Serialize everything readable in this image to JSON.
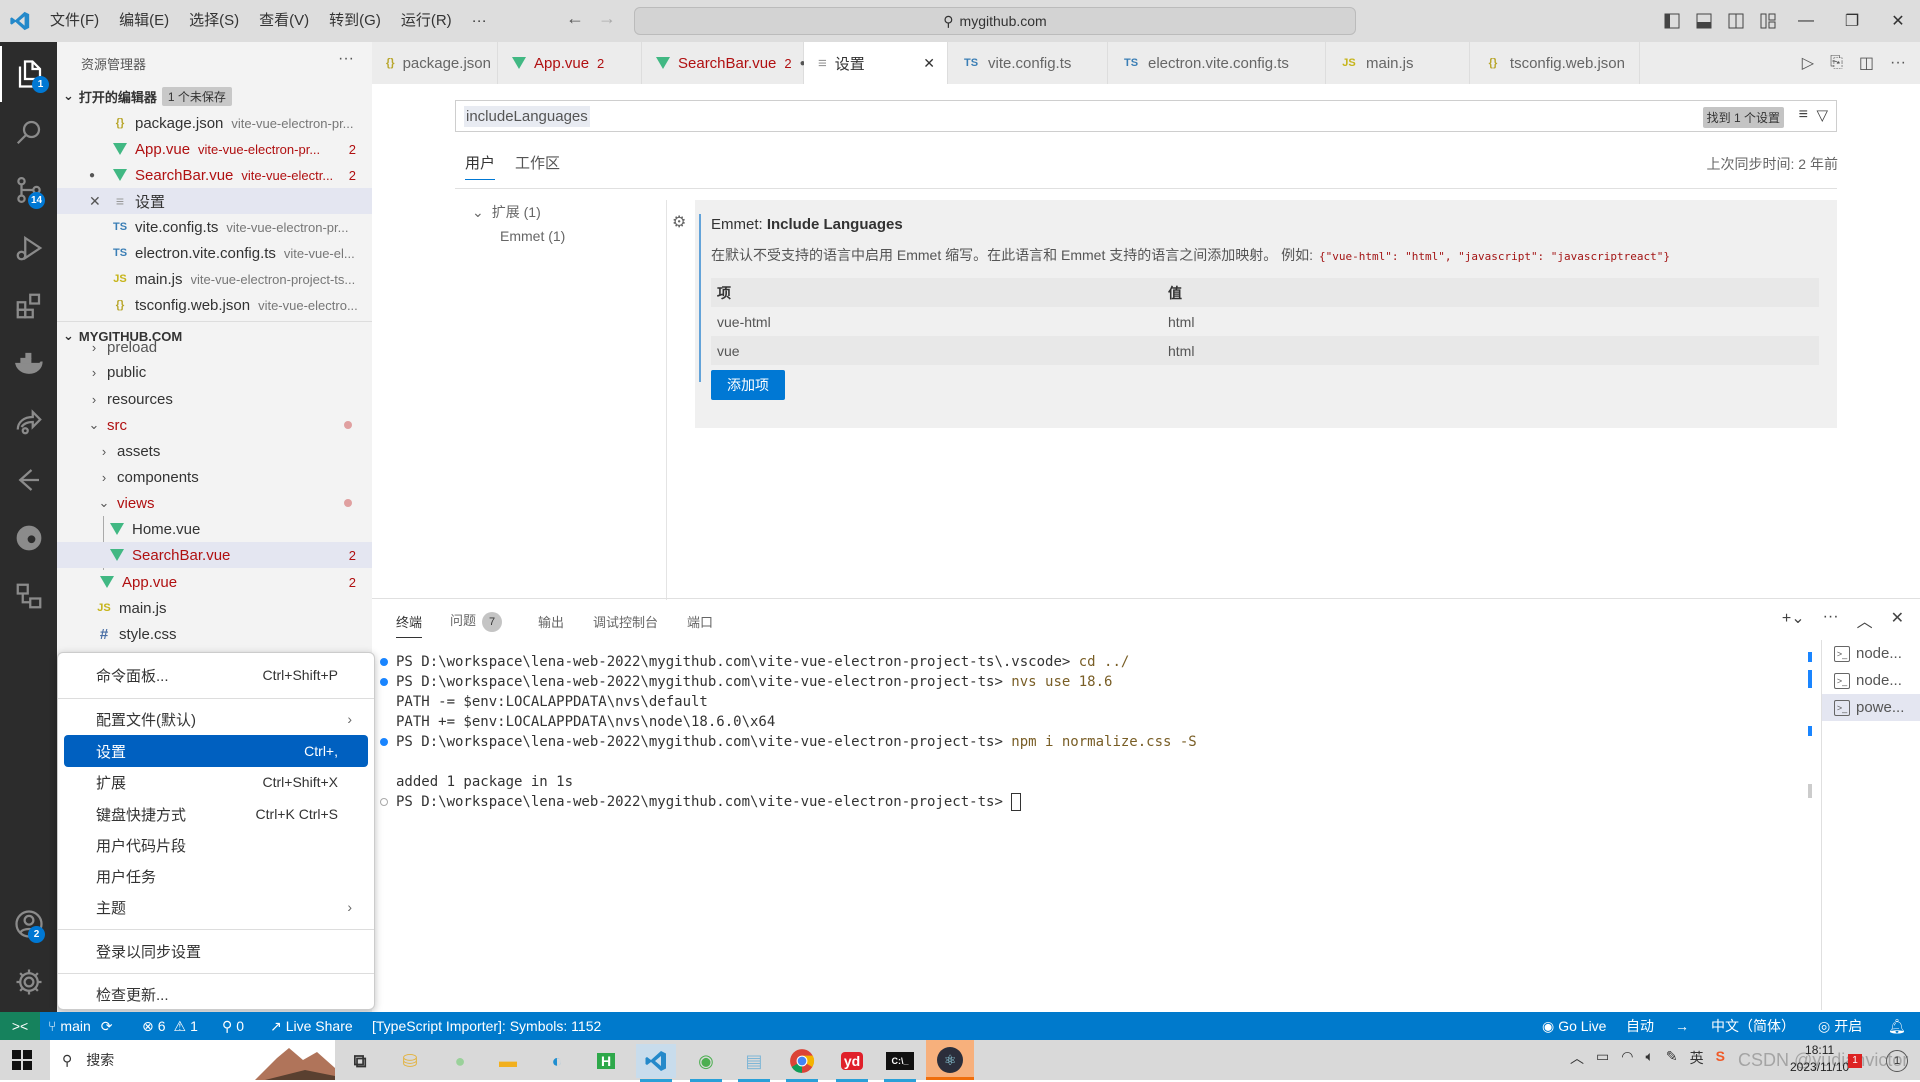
{
  "titlebar": {
    "menus": [
      "文件(F)",
      "编辑(E)",
      "选择(S)",
      "查看(V)",
      "转到(G)",
      "运行(R)",
      "···"
    ],
    "command_center": "mygithub.com"
  },
  "activity": {
    "explorer_badge": "1",
    "scm_badge": "14",
    "accounts_badge": "2"
  },
  "sidebar": {
    "title": "资源管理器",
    "more": "···",
    "open_editors": {
      "label": "打开的编辑器",
      "unsaved_badge": "1 个未保存",
      "items": [
        {
          "icon": "json-icon",
          "name": "package.json",
          "desc": "vite-vue-electron-pr...",
          "count": "",
          "error": false
        },
        {
          "icon": "vue-icon",
          "name": "App.vue",
          "desc": "vite-vue-electron-pr...",
          "count": "2",
          "error": true
        },
        {
          "icon": "vue-icon",
          "name": "SearchBar.vue",
          "desc": "vite-vue-electr...",
          "count": "2",
          "error": true
        },
        {
          "icon": "settings-file-icon",
          "name": "设置",
          "desc": "",
          "count": "",
          "error": false
        },
        {
          "icon": "ts-icon",
          "name": "vite.config.ts",
          "desc": "vite-vue-electron-pr...",
          "count": "",
          "error": false
        },
        {
          "icon": "ts-icon",
          "name": "electron.vite.config.ts",
          "desc": "vite-vue-el...",
          "count": "",
          "error": false
        },
        {
          "icon": "js-icon",
          "name": "main.js",
          "desc": "vite-vue-electron-project-ts...",
          "count": "",
          "error": false
        },
        {
          "icon": "json-icon",
          "name": "tsconfig.web.json",
          "desc": "vite-vue-electro...",
          "count": "",
          "error": false
        }
      ]
    },
    "workspace": {
      "label": "MYGITHUB.COM",
      "items": [
        {
          "name": "preload",
          "type": "folder"
        },
        {
          "name": "public",
          "type": "folder"
        },
        {
          "name": "resources",
          "type": "folder"
        },
        {
          "name": "src",
          "type": "folder-open"
        },
        {
          "name": "assets",
          "type": "folder"
        },
        {
          "name": "components",
          "type": "folder"
        },
        {
          "name": "views",
          "type": "folder-open"
        },
        {
          "name": "Home.vue",
          "type": "vue"
        },
        {
          "name": "SearchBar.vue",
          "type": "vue",
          "count": "2"
        },
        {
          "name": "App.vue",
          "type": "vue",
          "count": "2"
        },
        {
          "name": "main.js",
          "type": "js"
        },
        {
          "name": "style.css",
          "type": "css"
        }
      ]
    }
  },
  "tabs": [
    {
      "icon": "json-icon",
      "label": "package.json",
      "count": ""
    },
    {
      "icon": "vue-icon",
      "label": "App.vue",
      "count": "2"
    },
    {
      "icon": "vue-icon",
      "label": "SearchBar.vue",
      "count": "2"
    },
    {
      "icon": "settings-file-icon",
      "label": "设置",
      "count": ""
    },
    {
      "icon": "ts-icon",
      "label": "vite.config.ts",
      "count": ""
    },
    {
      "icon": "ts-icon",
      "label": "electron.vite.config.ts",
      "count": ""
    },
    {
      "icon": "js-icon",
      "label": "main.js",
      "count": ""
    },
    {
      "icon": "json-icon",
      "label": "tsconfig.web.json",
      "count": ""
    }
  ],
  "settings": {
    "search_value": "includeLanguages",
    "found_badge": "找到 1 个设置",
    "scope_tabs": [
      "用户",
      "工作区"
    ],
    "sync_time": "上次同步时间: 2 年前",
    "toc": {
      "group": "扩展 (1)",
      "item": "Emmet (1)"
    },
    "setting": {
      "category": "Emmet: ",
      "name": "Include Languages",
      "description": "在默认不受支持的语言中启用 Emmet 缩写。在此语言和 Emmet 支持的语言之间添加映射。 例如:",
      "example": "{\"vue-html\": \"html\", \"javascript\": \"javascriptreact\"}",
      "columns": [
        "项",
        "值"
      ],
      "rows": [
        {
          "key": "vue-html",
          "value": "html"
        },
        {
          "key": "vue",
          "value": "html"
        }
      ],
      "add_button": "添加项"
    }
  },
  "panel": {
    "tabs": [
      "终端",
      "问题",
      "输出",
      "调试控制台",
      "端口"
    ],
    "problems_count": "7",
    "terminal_lines": [
      {
        "marker": "blue",
        "prompt": "PS D:\\workspace\\lena-web-2022\\mygithub.com\\vite-vue-electron-project-ts\\.vscode> ",
        "cmd": "cd ../"
      },
      {
        "marker": "blue",
        "prompt": "PS D:\\workspace\\lena-web-2022\\mygithub.com\\vite-vue-electron-project-ts> ",
        "cmd": "nvs use 18.6"
      },
      {
        "marker": "",
        "prompt": "PATH -= $env:LOCALAPPDATA\\nvs\\default",
        "cmd": ""
      },
      {
        "marker": "",
        "prompt": "PATH += $env:LOCALAPPDATA\\nvs\\node\\18.6.0\\x64",
        "cmd": ""
      },
      {
        "marker": "blue",
        "prompt": "PS D:\\workspace\\lena-web-2022\\mygithub.com\\vite-vue-electron-project-ts> ",
        "cmd": "npm i normalize.css -S"
      },
      {
        "marker": "",
        "prompt": "",
        "cmd": ""
      },
      {
        "marker": "",
        "prompt": "added 1 package in 1s",
        "cmd": ""
      },
      {
        "marker": "hollow",
        "prompt": "PS D:\\workspace\\lena-web-2022\\mygithub.com\\vite-vue-electron-project-ts> ",
        "cmd": ""
      }
    ],
    "terminals": [
      "node...",
      "node...",
      "powe..."
    ]
  },
  "context_menu": {
    "items": [
      {
        "label": "命令面板...",
        "shortcut": "Ctrl+Shift+P"
      },
      {
        "label": "配置文件(默认)",
        "shortcut": "",
        "submenu": true
      },
      {
        "label": "设置",
        "shortcut": "Ctrl+,",
        "highlighted": true
      },
      {
        "label": "扩展",
        "shortcut": "Ctrl+Shift+X"
      },
      {
        "label": "键盘快捷方式",
        "shortcut": "Ctrl+K Ctrl+S"
      },
      {
        "label": "用户代码片段",
        "shortcut": ""
      },
      {
        "label": "用户任务",
        "shortcut": ""
      },
      {
        "label": "主题",
        "shortcut": "",
        "submenu": true
      },
      {
        "label": "登录以同步设置",
        "shortcut": ""
      },
      {
        "label": "检查更新...",
        "shortcut": ""
      }
    ]
  },
  "statusbar": {
    "branch": "main",
    "errors": "6",
    "warnings": "1",
    "ports": "0",
    "live_share": "Live Share",
    "ts_importer": "[TypeScript Importer]: Symbols: 1152",
    "go_live": "Go Live",
    "auto": "自动",
    "arrow": "→",
    "language": "中文（简体）",
    "open": "开启"
  },
  "taskbar": {
    "search_placeholder": "搜索",
    "time": "18:11",
    "date": "2023/11/10",
    "ime": "英",
    "watermark": "CSDN @yudianvictor",
    "notif_count": "1"
  },
  "colors": {
    "accent": "#007acc",
    "error": "#b01011",
    "vue_green": "#41b883",
    "menu_highlight": "#0060c0",
    "remote_green": "#16825d"
  }
}
